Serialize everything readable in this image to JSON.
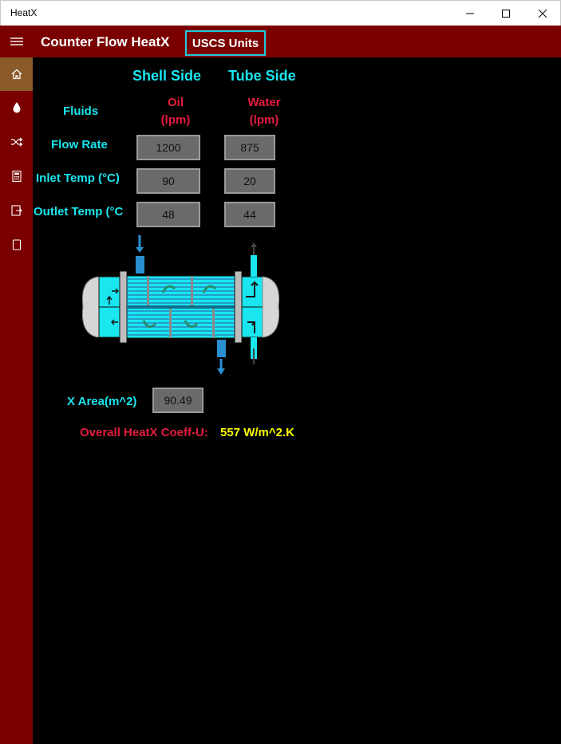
{
  "window": {
    "title": "HeatX"
  },
  "header": {
    "title": "Counter Flow HeatX",
    "units_button": "USCS Units"
  },
  "nav": {
    "items": [
      {
        "name": "home",
        "icon": "home-icon",
        "active": true
      },
      {
        "name": "fluid",
        "icon": "droplet-icon",
        "active": false
      },
      {
        "name": "flow",
        "icon": "shuffle-icon",
        "active": false
      },
      {
        "name": "calculator",
        "icon": "calculator-icon",
        "active": false
      },
      {
        "name": "export",
        "icon": "export-icon",
        "active": false
      },
      {
        "name": "page",
        "icon": "page-icon",
        "active": false
      }
    ]
  },
  "columns": {
    "shell": "Shell Side",
    "tube": "Tube Side"
  },
  "labels": {
    "fluids": "Fluids",
    "flow_rate": "Flow Rate",
    "inlet_temp": "Inlet Temp (°C)",
    "outlet_temp": "Outlet Temp (°C"
  },
  "shell": {
    "fluid": "Oil",
    "unit": "(lpm)",
    "flow_rate": "1200",
    "inlet_temp": "90",
    "outlet_temp": "48"
  },
  "tube": {
    "fluid": "Water",
    "unit": "(lpm)",
    "flow_rate": "875",
    "inlet_temp": "20",
    "outlet_temp": "44"
  },
  "area": {
    "label": "X Area(m^2)",
    "value": "90.49"
  },
  "coefficient": {
    "label": "Overall HeatX Coeff-U:",
    "value": "557 W/m^2.K"
  },
  "colors": {
    "accent_cyan": "#19e6ef",
    "label_red": "#e31c3d",
    "value_yellow": "#ffff00",
    "header_bg": "#7a0000",
    "nav_active": "#8b5a2b"
  }
}
